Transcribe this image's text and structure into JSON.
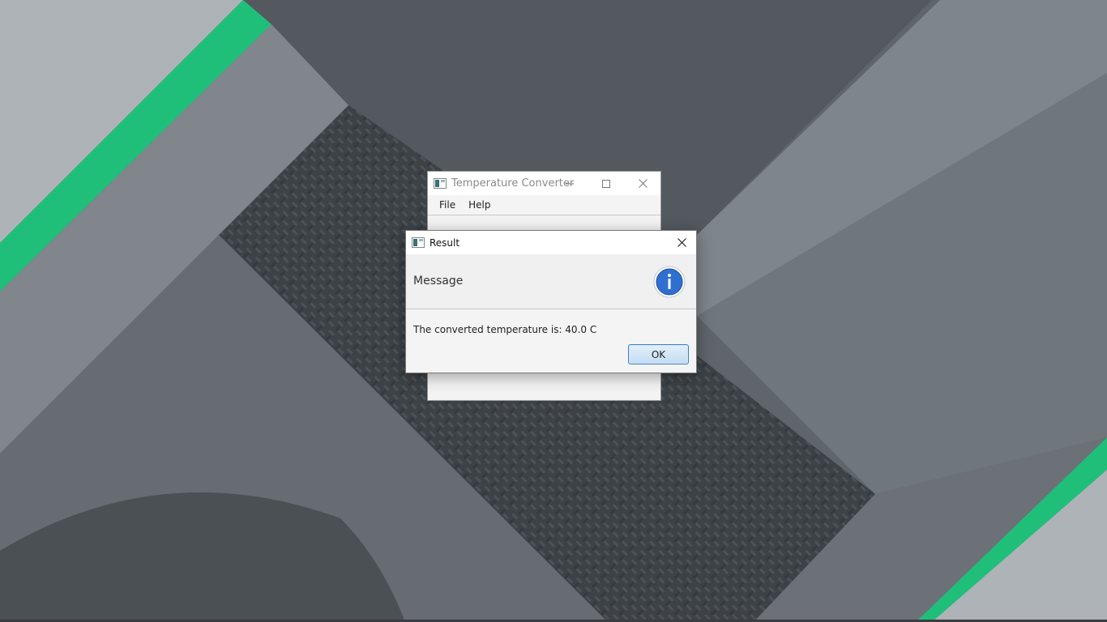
{
  "main_window": {
    "title": "Temperature Converter",
    "menu": [
      {
        "label": "File"
      },
      {
        "label": "Help"
      }
    ],
    "caption_buttons": {
      "minimize_icon": "minimize-icon",
      "maximize_icon": "maximize-icon",
      "close_icon": "close-icon"
    }
  },
  "dialog": {
    "title": "Result",
    "header_text": "Message",
    "icon": "info-icon",
    "content_text": "The converted temperature is: 40.0 C",
    "ok_label": "OK",
    "close_icon": "close-icon"
  },
  "colors": {
    "accent_green": "#1fbf7a",
    "button_border": "#3d7fc4",
    "info_blue": "#2f6fd0"
  }
}
